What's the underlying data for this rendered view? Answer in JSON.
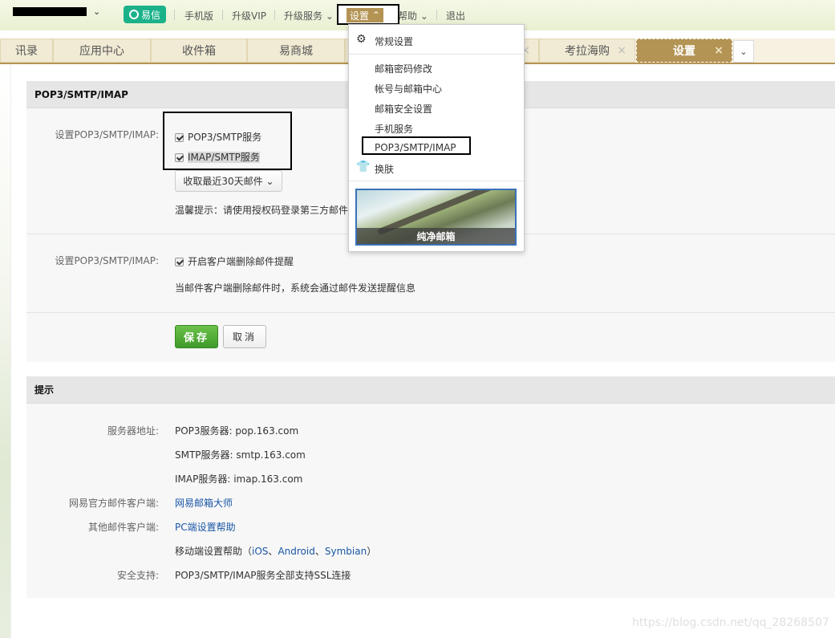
{
  "topbar": {
    "account_chevron": "⌄",
    "yixin_label": "易信",
    "links": {
      "mobile": "手机版",
      "vip": "升级VIP",
      "upgrade_service": "升级服务",
      "settings": "设置",
      "help": "帮助",
      "logout": "退出"
    }
  },
  "tabs": {
    "contacts_partial": "讯录",
    "app_center": "应用中心",
    "favorites": "收件箱",
    "yishang": "易商城",
    "kaola": "考拉海购",
    "settings": "设置",
    "close": "×"
  },
  "dropdown": {
    "general": "常规设置",
    "password": "邮箱密码修改",
    "account_center": "帐号与邮箱中心",
    "security": "邮箱安全设置",
    "mobile_service": "手机服务",
    "pop3": "POP3/SMTP/IMAP",
    "skin": "换肤",
    "skin_caption": "纯净邮箱"
  },
  "panel1": {
    "header": "POP3/SMTP/IMAP",
    "row1_label": "设置POP3/SMTP/IMAP:",
    "opt_pop3": "POP3/SMTP服务",
    "opt_imap": "IMAP/SMTP服务",
    "recent_select": "收取最近30天邮件",
    "tip": "温馨提示：请使用授权码登录第三方邮件",
    "row2_label": "设置POP3/SMTP/IMAP:",
    "opt_delete_notice": "开启客户端删除邮件提醒",
    "delete_desc": "当邮件客户端删除邮件时，系统会通过邮件发送提醒信息",
    "save": "保存",
    "cancel": "取消"
  },
  "panel2": {
    "header": "提示",
    "server_label": "服务器地址:",
    "pop3_server": "POP3服务器: pop.163.com",
    "smtp_server": "SMTP服务器: smtp.163.com",
    "imap_server": "IMAP服务器: imap.163.com",
    "official_client_label": "网易官方邮件客户端:",
    "official_client": "网易邮箱大师",
    "other_client_label": "其他邮件客户端:",
    "pc_help": "PC端设置帮助",
    "mobile_help_prefix": "移动端设置帮助（",
    "ios": "iOS",
    "comma1": "、",
    "android": "Android",
    "comma2": "、",
    "symbian": "Symbian",
    "mobile_help_suffix": "）",
    "security_label": "安全支持:",
    "security_text": "POP3/SMTP/IMAP服务全部支持SSL连接"
  },
  "watermark": "https://blog.csdn.net/qq_28268507"
}
